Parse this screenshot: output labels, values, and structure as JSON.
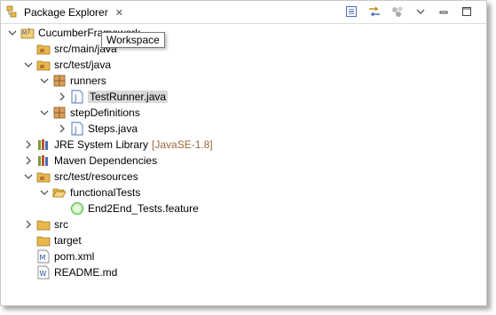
{
  "view": {
    "title": "Package Explorer",
    "close_glyph": "✕",
    "toolbar": {
      "icons": [
        "collapse-all-icon",
        "link-with-editor-icon",
        "focus-icon",
        "view-menu-icon",
        "minimize-icon",
        "maximize-icon"
      ]
    }
  },
  "tooltip": {
    "text": "Workspace"
  },
  "tree": {
    "project": "CucumberFramework",
    "items": [
      {
        "label": "src/main/java"
      },
      {
        "label": "src/test/java"
      },
      {
        "label": "runners"
      },
      {
        "label": "TestRunner.java"
      },
      {
        "label": "stepDefinitions"
      },
      {
        "label": "Steps.java"
      },
      {
        "label": "JRE System Library",
        "decoration": "[JavaSE-1.8]"
      },
      {
        "label": "Maven Dependencies"
      },
      {
        "label": "src/test/resources"
      },
      {
        "label": "functionalTests"
      },
      {
        "label": "End2End_Tests.feature"
      },
      {
        "label": "src"
      },
      {
        "label": "target"
      },
      {
        "label": "pom.xml"
      },
      {
        "label": "README.md"
      }
    ]
  },
  "colors": {
    "selection": "#d9d9d9",
    "decoration": "#9a6a3a",
    "folder": "#e8b84a",
    "package": "#b5783c",
    "java": "#4a6fb5"
  }
}
